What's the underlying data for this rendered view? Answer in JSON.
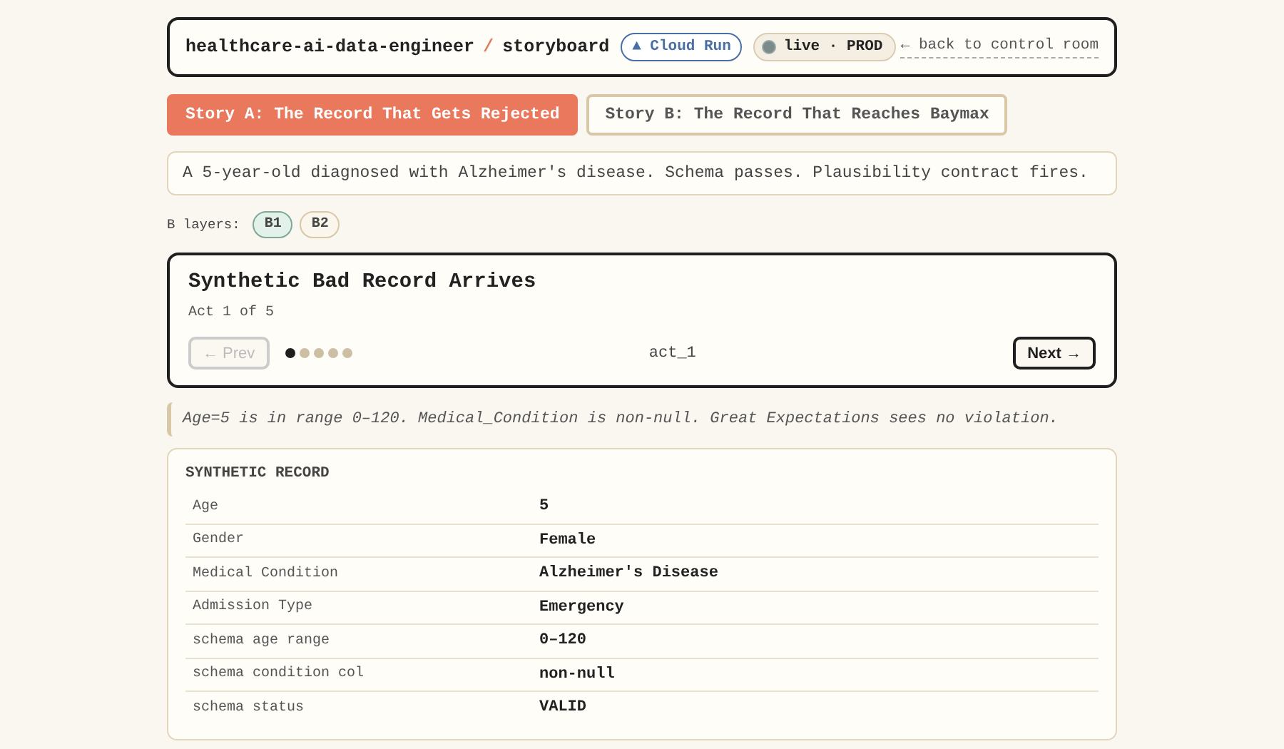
{
  "header": {
    "project": "healthcare-ai-data-engineer",
    "separator": "/",
    "page": "storyboard",
    "platform_badge": "▲ Cloud Run",
    "status_badge": {
      "label": "live · PROD",
      "live": true
    },
    "back_link": "← back to control room"
  },
  "story_tabs": [
    {
      "label": "Story A: The Record That Gets Rejected",
      "selected": true
    },
    {
      "label": "Story B: The Record That Reaches Baymax",
      "selected": false
    }
  ],
  "summary": "A 5-year-old diagnosed with Alzheimer's disease. Schema passes. Plausibility contract fires.",
  "layers": {
    "label": "B layers:",
    "items": [
      {
        "label": "B1",
        "selected": true
      },
      {
        "label": "B2",
        "selected": false
      }
    ]
  },
  "act": {
    "title": "Synthetic Bad Record Arrives",
    "counter": "Act 1 of 5",
    "prev": {
      "label": "← Prev",
      "disabled": true
    },
    "dots": [
      {
        "selected": true
      },
      {
        "selected": false
      },
      {
        "selected": false
      },
      {
        "selected": false
      },
      {
        "selected": false
      }
    ],
    "act_id": "act_1",
    "next": {
      "label": "Next →",
      "disabled": false
    }
  },
  "note": "Age=5 is in range 0–120. Medical_Condition is non-null. Great Expectations sees no violation.",
  "record": {
    "title": "SYNTHETIC RECORD",
    "rows": [
      {
        "field": "Age",
        "value": "5"
      },
      {
        "field": "Gender",
        "value": "Female"
      },
      {
        "field": "Medical Condition",
        "value": "Alzheimer's Disease"
      },
      {
        "field": "Admission Type",
        "value": "Emergency"
      },
      {
        "field": "schema age range",
        "value": "0–120"
      },
      {
        "field": "schema condition col",
        "value": "non-null"
      },
      {
        "field": "schema status",
        "value": "VALID"
      }
    ]
  }
}
